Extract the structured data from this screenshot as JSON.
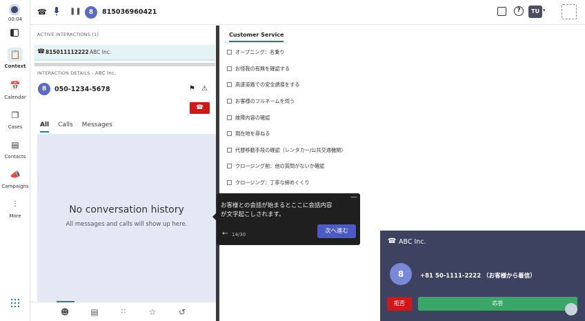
{
  "top": {
    "timer": "00:04",
    "phone_number": "815036960421",
    "avatar_num": "8",
    "user_initials": "TU"
  },
  "nav": {
    "items": [
      {
        "label": "Context"
      },
      {
        "label": "Calendar"
      },
      {
        "label": "Cases"
      },
      {
        "label": "Contacts"
      },
      {
        "label": "Campaigns"
      },
      {
        "label": "More"
      }
    ]
  },
  "left": {
    "active_label": "ACTIVE INTERACTIONS (1)",
    "active_number": "815011112222",
    "active_company": "ABC Inc.",
    "details_label": "INTERACTION DETAILS",
    "details_company": "ABC Inc.",
    "details_avatar": "8",
    "details_phone": "050-1234-5678",
    "tabs": [
      "All",
      "Calls",
      "Messages"
    ],
    "empty_title": "No conversation history",
    "empty_sub": "All messages and calls will show up here."
  },
  "right": {
    "tab": "Customer Service",
    "checklist": [
      "オープニング：名乗り",
      "お怪我の有無を確認する",
      "高速道路での安全誘導をする",
      "お客様のフルネームを伺う",
      "故障内容の確認",
      "現在地を尋ねる",
      "代替移動手段の確認（レンタカー/公共交通機関）",
      "クロージング前：他の質問がないか確認",
      "クロージング：丁寧な締めくくり"
    ]
  },
  "tooltip": {
    "text_line1": "お客様との会話が始まるとここに会話内容",
    "text_line2": "が文字起こしされます。",
    "progress": "14/30",
    "next_label": "次へ進む"
  },
  "callcard": {
    "company": "ABC Inc.",
    "avatar": "8",
    "caller": "+81 50-1111-2222 （お客様から着信）",
    "reject_label": "拒否",
    "accept_label": "応答"
  },
  "colors": {
    "accent": "#2a7d8c",
    "reject": "#d0181b",
    "accept": "#3aa668",
    "card_bg": "#3d4260",
    "avatar": "#5c6bc0"
  }
}
